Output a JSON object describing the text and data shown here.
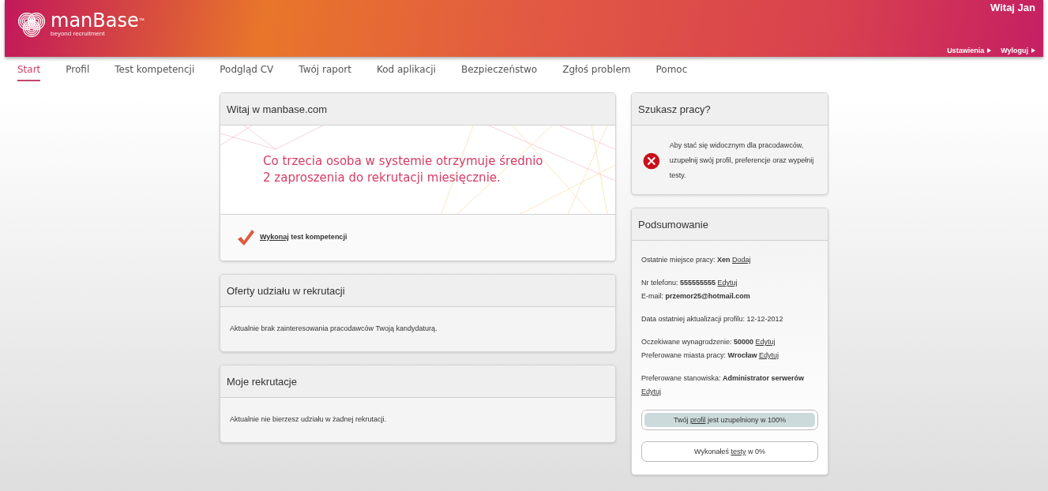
{
  "header": {
    "logo_name": "manBase",
    "logo_tm": "™",
    "logo_tagline": "beyond recruitment",
    "greeting": "Witaj Jan",
    "links": [
      "Ustawienia",
      "Wyloguj"
    ]
  },
  "nav": [
    {
      "label": "Start",
      "selected": true
    },
    {
      "label": "Profil",
      "selected": false
    },
    {
      "label": "Test kompetencji",
      "selected": false
    },
    {
      "label": "Podgląd CV",
      "selected": false
    },
    {
      "label": "Twój raport",
      "selected": false
    },
    {
      "label": "Kod aplikacji",
      "selected": false
    },
    {
      "label": "Bezpieczeństwo",
      "selected": false
    },
    {
      "label": "Zgłoś problem",
      "selected": false
    },
    {
      "label": "Pomoc",
      "selected": false
    }
  ],
  "welcome": {
    "title": "Witaj w manbase.com",
    "banner_lines": [
      "Co trzecia osoba w systemie otrzymuje średnio",
      "2 zaproszenia do rekrutacji miesięcznie."
    ],
    "task_link": "Wykonaj",
    "task_text": "test kompetencji"
  },
  "offers": {
    "title": "Oferty udziału w rekrutacji",
    "text": "Aktualnie brak zainteresowania pracodawców Twoją kandydaturą."
  },
  "recruitments": {
    "title": "Moje rekrutacje",
    "text": "Aktualnie nie bierzesz udziału w żadnej rekrutacji."
  },
  "job_search": {
    "title": "Szukasz pracy?",
    "text": "Aby stać się widocznym dla pracodawców, uzupełnij swój profil, preferencje oraz wypełnij testy."
  },
  "summary": {
    "title": "Podsumowanie",
    "groups": [
      [
        {
          "text": "Ostatnie miejsce pracy: **Xen**",
          "link": "Dodaj"
        }
      ],
      [
        {
          "text": "Nr telefonu: **555555555**",
          "link": "Edytuj"
        },
        {
          "text": "E-mail: **przemor25@hotmail.com**"
        }
      ],
      [
        {
          "text": "Data ostatniej aktualizacji profilu: 12-12-2012"
        }
      ],
      [
        {
          "text": "Oczekiwane wynagrodzenie: **50000**",
          "link": "Edytuj"
        },
        {
          "text": "Preferowane miasta pracy: **Wrocław**",
          "link": "Edytuj"
        }
      ],
      [
        {
          "text": "Preferowane stanowiska: **Administrator serwerów**",
          "link": "Edytuj"
        }
      ]
    ],
    "progress": [
      {
        "before": "Twój",
        "link": "profil",
        "after": "jest uzupelniony w 100%",
        "level": 1
      },
      {
        "before": "Wykonałeś",
        "link": "testy",
        "after": "w 0%",
        "level": 0
      }
    ]
  }
}
